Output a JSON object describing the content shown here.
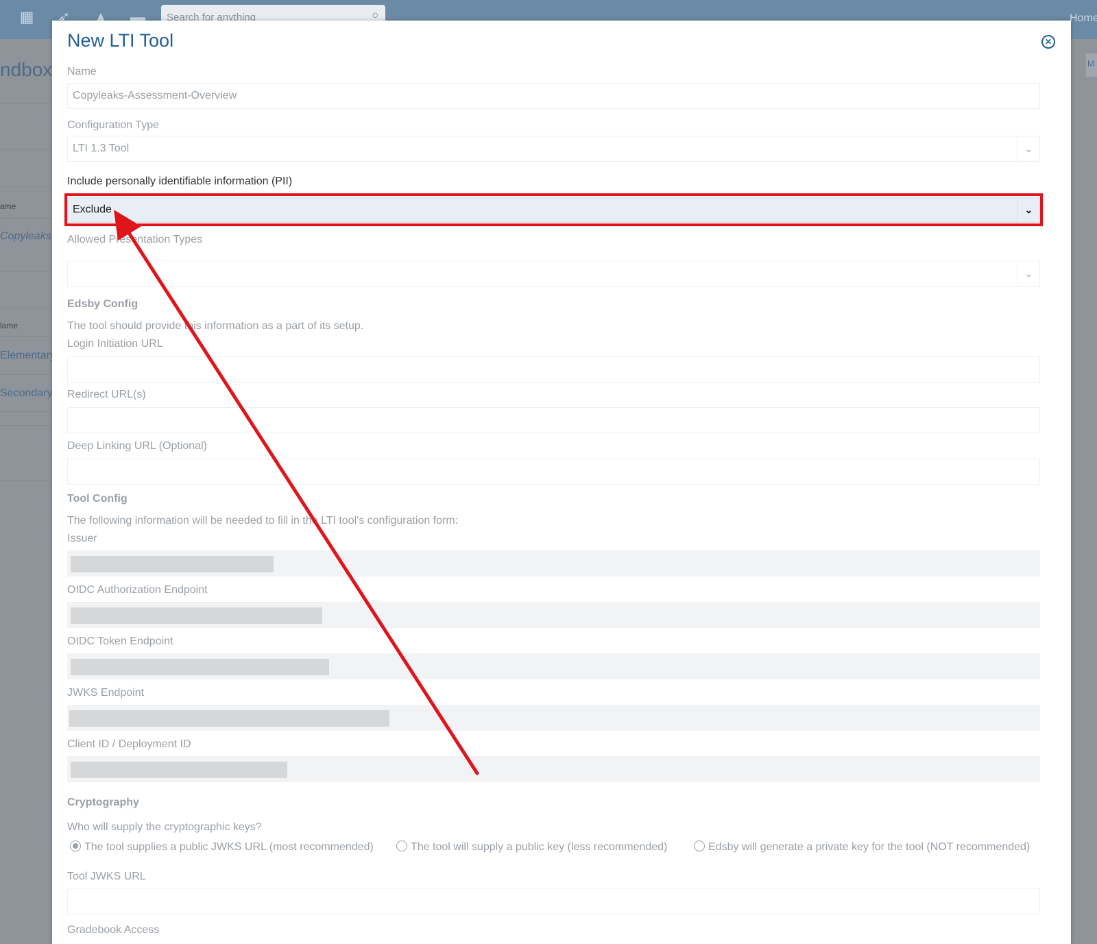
{
  "app": {
    "search_placeholder": "Search for anything",
    "home_label": "Home",
    "page_title_fragment": "ndbox",
    "right_tab_fragment": "M",
    "left_column": {
      "header_1": "ame",
      "link_1": "Copyleaks S",
      "header_2": "lame",
      "link_2": "Elementary",
      "link_3": "Secondary"
    }
  },
  "modal": {
    "title": "New LTI Tool",
    "close_icon": "close-circle-icon",
    "name": {
      "label": "Name",
      "value": "Copyleaks-Assessment-Overview"
    },
    "config_type": {
      "label": "Configuration Type",
      "value": "LTI 1.3 Tool"
    },
    "pii": {
      "label": "Include personally identifiable information (PII)",
      "value": "Exclude"
    },
    "presentation": {
      "label": "Allowed Presentation Types",
      "value": ""
    },
    "edsby_config": {
      "heading": "Edsby Config",
      "help": "The tool should provide this information as a part of its setup.",
      "login_url_label": "Login Initiation URL",
      "redirect_label": "Redirect URL(s)",
      "deep_link_label": "Deep Linking URL (Optional)"
    },
    "tool_config": {
      "heading": "Tool Config",
      "help": "The following information will be needed to fill in the LTI tool's configuration form:",
      "issuer_label": "Issuer",
      "oidc_auth_label": "OIDC Authorization Endpoint",
      "oidc_token_label": "OIDC Token Endpoint",
      "jwks_label": "JWKS Endpoint",
      "client_label": "Client ID / Deployment ID"
    },
    "cryptography": {
      "heading": "Cryptography",
      "question": "Who will supply the cryptographic keys?",
      "options": [
        {
          "label": "The tool supplies a public JWKS URL (most recommended)",
          "selected": true
        },
        {
          "label": "The tool will supply a public key (less recommended)",
          "selected": false
        },
        {
          "label": "Edsby will generate a private key for the tool (NOT recommended)",
          "selected": false
        }
      ],
      "jwks_url_label": "Tool JWKS URL"
    },
    "gradebook_label": "Gradebook Access"
  },
  "colors": {
    "accent": "#1f5f96",
    "annotation_red": "#e0141b",
    "topbar": "#6b8aa6"
  }
}
